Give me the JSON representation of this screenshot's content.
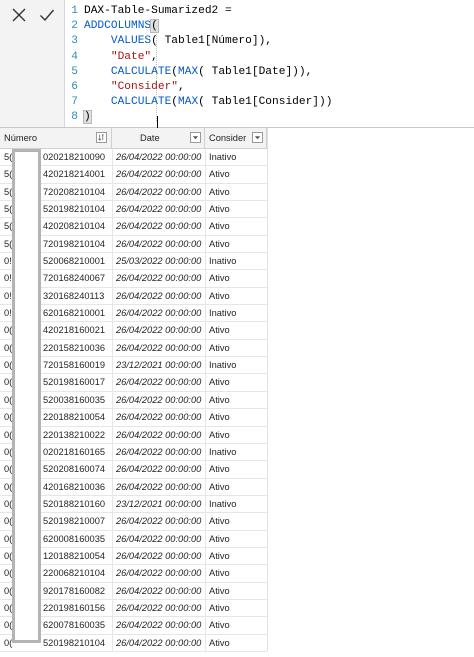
{
  "formula_bar": {
    "cancel_icon": "close-icon",
    "commit_icon": "checkmark-icon",
    "lines": [
      {
        "num": "1",
        "segments": [
          {
            "text": "DAX-Table-Sumarized2 = ",
            "cls": ""
          }
        ]
      },
      {
        "num": "2",
        "segments": [
          {
            "text": "ADDCOLUMNS",
            "cls": "kw"
          },
          {
            "text": "(",
            "cls": "paren-hl"
          }
        ]
      },
      {
        "num": "3",
        "segments": [
          {
            "text": "    ",
            "cls": ""
          },
          {
            "text": "VALUES",
            "cls": "kw"
          },
          {
            "text": "( Table1[Número]),",
            "cls": ""
          }
        ]
      },
      {
        "num": "4",
        "segments": [
          {
            "text": "    ",
            "cls": ""
          },
          {
            "text": "\"Date\"",
            "cls": "str"
          },
          {
            "text": ",",
            "cls": ""
          }
        ]
      },
      {
        "num": "5",
        "segments": [
          {
            "text": "    ",
            "cls": ""
          },
          {
            "text": "CALCULATE",
            "cls": "kw"
          },
          {
            "text": "(",
            "cls": ""
          },
          {
            "text": "MAX",
            "cls": "kw"
          },
          {
            "text": "( Table1[Date])),",
            "cls": ""
          }
        ]
      },
      {
        "num": "6",
        "segments": [
          {
            "text": "    ",
            "cls": ""
          },
          {
            "text": "\"Consider\"",
            "cls": "str"
          },
          {
            "text": ",",
            "cls": ""
          }
        ]
      },
      {
        "num": "7",
        "segments": [
          {
            "text": "    ",
            "cls": ""
          },
          {
            "text": "CALCULATE",
            "cls": "kw"
          },
          {
            "text": "(",
            "cls": ""
          },
          {
            "text": "MAX",
            "cls": "kw"
          },
          {
            "text": "( Table1[Consider]))",
            "cls": ""
          }
        ]
      },
      {
        "num": "8",
        "segments": [
          {
            "text": ")",
            "cls": "paren-hl"
          }
        ]
      }
    ]
  },
  "table": {
    "columns": {
      "numero": "Número",
      "date": "Date",
      "consider": "Consider"
    },
    "header_icons": {
      "numero": "sort-descending-icon",
      "date": "dropdown-icon",
      "consider": "dropdown-icon"
    },
    "rows": [
      {
        "prefix": "5(",
        "num": "020218210090",
        "date": "26/04/2022 00:00:00",
        "consider": "Inativo"
      },
      {
        "prefix": "5(",
        "num": "420218214001",
        "date": "26/04/2022 00:00:00",
        "consider": "Ativo"
      },
      {
        "prefix": "5(",
        "num": "720208210104",
        "date": "26/04/2022 00:00:00",
        "consider": "Ativo"
      },
      {
        "prefix": "5(",
        "num": "520198210104",
        "date": "26/04/2022 00:00:00",
        "consider": "Ativo"
      },
      {
        "prefix": "5(",
        "num": "420208210104",
        "date": "26/04/2022 00:00:00",
        "consider": "Ativo"
      },
      {
        "prefix": "5(",
        "num": "720198210104",
        "date": "26/04/2022 00:00:00",
        "consider": "Ativo"
      },
      {
        "prefix": "0!",
        "num": "520068210001",
        "date": "25/03/2022 00:00:00",
        "consider": "Inativo"
      },
      {
        "prefix": "0!",
        "num": "720168240067",
        "date": "26/04/2022 00:00:00",
        "consider": "Ativo"
      },
      {
        "prefix": "0!",
        "num": "320168240113",
        "date": "26/04/2022 00:00:00",
        "consider": "Ativo"
      },
      {
        "prefix": "0!",
        "num": "620168210001",
        "date": "26/04/2022 00:00:00",
        "consider": "Inativo"
      },
      {
        "prefix": "0(",
        "num": "420218160021",
        "date": "26/04/2022 00:00:00",
        "consider": "Ativo"
      },
      {
        "prefix": "0(",
        "num": "220158210036",
        "date": "26/04/2022 00:00:00",
        "consider": "Ativo"
      },
      {
        "prefix": "0(",
        "num": "720158160019",
        "date": "23/12/2021 00:00:00",
        "consider": "Inativo"
      },
      {
        "prefix": "0(",
        "num": "520198160017",
        "date": "26/04/2022 00:00:00",
        "consider": "Ativo"
      },
      {
        "prefix": "0(",
        "num": "520038160035",
        "date": "26/04/2022 00:00:00",
        "consider": "Ativo"
      },
      {
        "prefix": "0(",
        "num": "220188210054",
        "date": "26/04/2022 00:00:00",
        "consider": "Ativo"
      },
      {
        "prefix": "0(",
        "num": "220138210022",
        "date": "26/04/2022 00:00:00",
        "consider": "Ativo"
      },
      {
        "prefix": "0(",
        "num": "020218160165",
        "date": "26/04/2022 00:00:00",
        "consider": "Inativo"
      },
      {
        "prefix": "0(",
        "num": "520208160074",
        "date": "26/04/2022 00:00:00",
        "consider": "Ativo"
      },
      {
        "prefix": "0(",
        "num": "420168210036",
        "date": "26/04/2022 00:00:00",
        "consider": "Ativo"
      },
      {
        "prefix": "0(",
        "num": "520188210160",
        "date": "23/12/2021 00:00:00",
        "consider": "Inativo"
      },
      {
        "prefix": "0(",
        "num": "520198210007",
        "date": "26/04/2022 00:00:00",
        "consider": "Ativo"
      },
      {
        "prefix": "0(",
        "num": "620008160035",
        "date": "26/04/2022 00:00:00",
        "consider": "Ativo"
      },
      {
        "prefix": "0(",
        "num": "120188210054",
        "date": "26/04/2022 00:00:00",
        "consider": "Ativo"
      },
      {
        "prefix": "0(",
        "num": "220068210104",
        "date": "26/04/2022 00:00:00",
        "consider": "Ativo"
      },
      {
        "prefix": "0(",
        "num": "920178160082",
        "date": "26/04/2022 00:00:00",
        "consider": "Ativo"
      },
      {
        "prefix": "0(",
        "num": "220198160156",
        "date": "26/04/2022 00:00:00",
        "consider": "Ativo"
      },
      {
        "prefix": "0(",
        "num": "620078160035",
        "date": "26/04/2022 00:00:00",
        "consider": "Ativo"
      },
      {
        "prefix": "0(",
        "num": "520198210104",
        "date": "26/04/2022 00:00:00",
        "consider": "Ativo"
      }
    ]
  }
}
